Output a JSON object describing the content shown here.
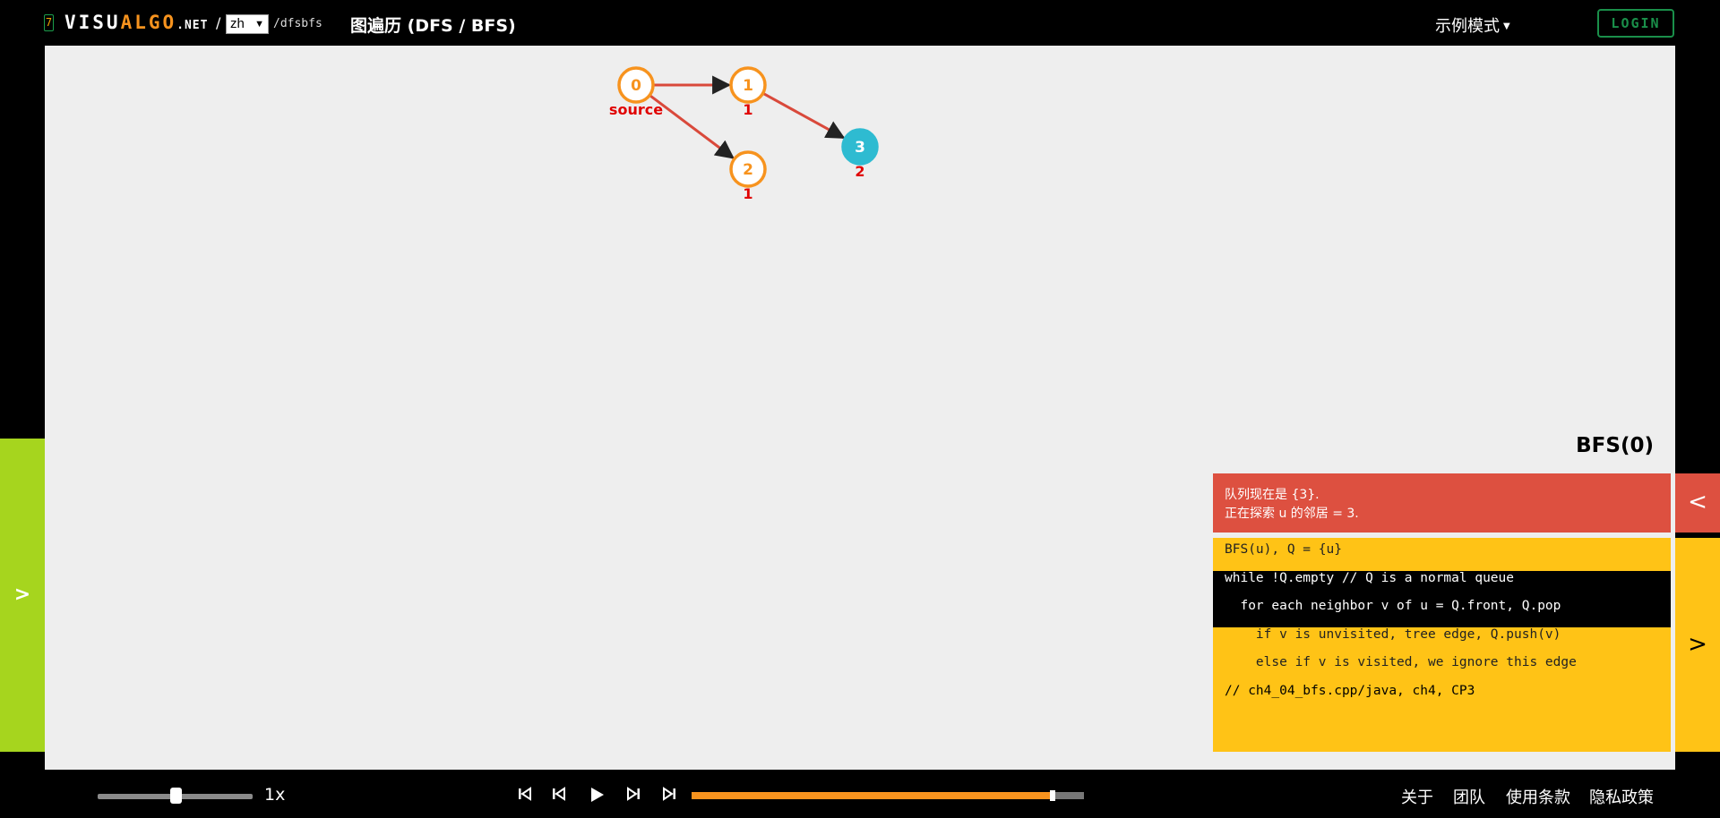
{
  "header": {
    "badge": "7",
    "logo_visu": "VISU",
    "logo_algo": "ALGO",
    "logo_net": ".NET",
    "slash": "/",
    "language": "zh",
    "path": "/dfsbfs",
    "title": "图遍历 (DFS / BFS)",
    "mode_menu": "示例模式",
    "login": "LOGIN"
  },
  "graph": {
    "nodes": [
      {
        "id": "0",
        "state": "frontier",
        "label": "source"
      },
      {
        "id": "1",
        "state": "frontier",
        "label": "1"
      },
      {
        "id": "2",
        "state": "frontier",
        "label": "1"
      },
      {
        "id": "3",
        "state": "current",
        "label": "2"
      }
    ],
    "edges": [
      {
        "from": "0",
        "to": "1"
      },
      {
        "from": "0",
        "to": "2"
      },
      {
        "from": "1",
        "to": "3"
      }
    ],
    "colors": {
      "frontier": "#f7931e",
      "current": "#2ebbd1",
      "edge": "#d9493b",
      "label": "#e00000"
    }
  },
  "left_tab": ">",
  "panel": {
    "algo_title": "BFS(0)",
    "status_lines": [
      "队列现在是 {3}.",
      "正在探索 u 的邻居 = 3."
    ],
    "code_lines": [
      {
        "text": "BFS(u), Q = {u}",
        "active": false
      },
      {
        "text": "while !Q.empty // Q is a normal queue",
        "active": true
      },
      {
        "text": "  for each neighbor v of u = Q.front, Q.pop",
        "active": true
      },
      {
        "text": "    if v is unvisited, tree edge, Q.push(v)",
        "active": false
      },
      {
        "text": "    else if v is visited, we ignore this edge",
        "active": false
      },
      {
        "text": "// ch4_04_bfs.cpp/java, ch4, CP3",
        "active": false
      }
    ],
    "prev_icon": "<",
    "next_icon": ">"
  },
  "controls": {
    "speed_label": "1x",
    "speed_level": 0.5,
    "progress_fraction": 0.92,
    "icons": [
      "go-to-start-icon",
      "step-backward-icon",
      "play-icon",
      "step-forward-icon",
      "go-to-end-icon"
    ]
  },
  "footer": {
    "links": [
      "关于",
      "团队",
      "使用条款",
      "隐私政策"
    ]
  }
}
